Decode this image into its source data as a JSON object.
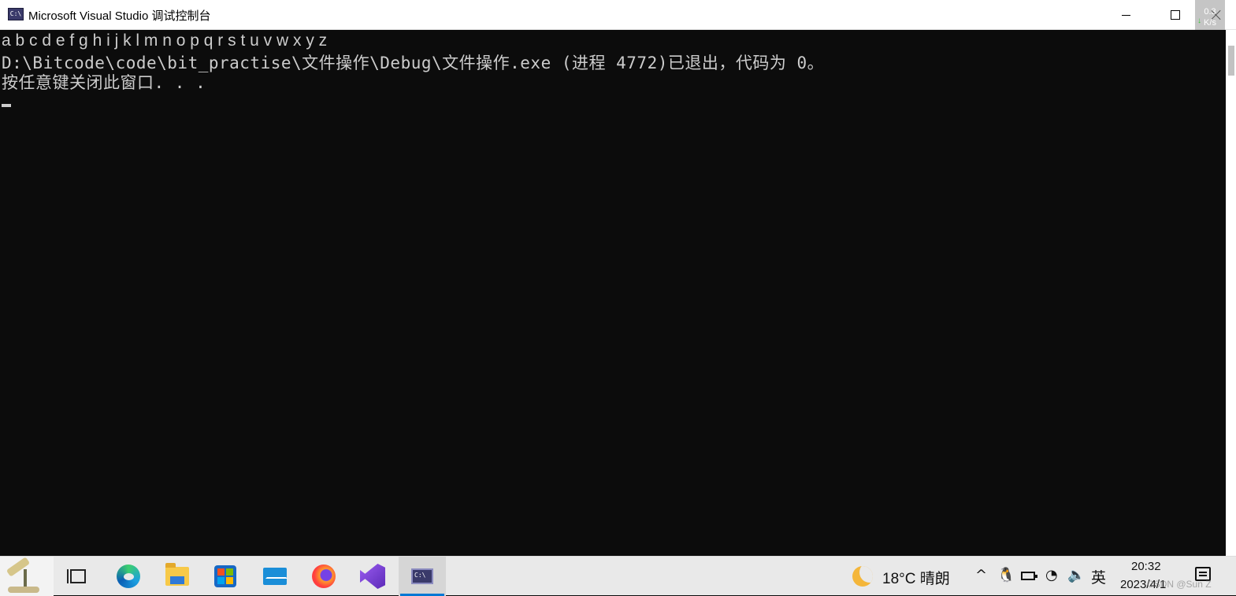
{
  "window": {
    "title": "Microsoft Visual Studio 调试控制台",
    "icon_label": "C:\\"
  },
  "console": {
    "lines": [
      "a b c d e f g h i j k l m n o p q r s t u v w x y z",
      "D:\\Bitcode\\code\\bit_practise\\文件操作\\Debug\\文件操作.exe (进程 4772)已退出，代码为 0。",
      "按任意键关闭此窗口. . ."
    ]
  },
  "net_overlay": {
    "line1": "0.3",
    "line2": "K/s"
  },
  "taskbar": {
    "weather": "18°C  晴朗",
    "ime": "英",
    "time": "20:32",
    "date": "2023/4/1",
    "watermark": "CSDN @Sun Z"
  },
  "colors": {
    "console_bg": "#0c0c0c",
    "console_fg": "#cccccc",
    "taskbar_bg": "#e9e9e9",
    "accent": "#0078d4"
  }
}
